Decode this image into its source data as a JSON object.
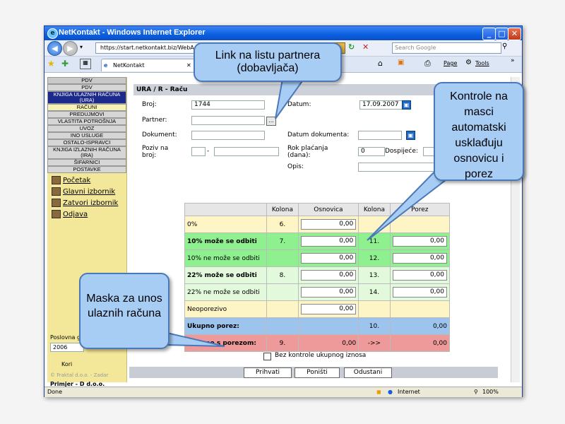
{
  "window": {
    "title": "NetKontakt - Windows Internet Explorer"
  },
  "browser": {
    "url": "https://start.netkontakt.biz/WebA",
    "search_placeholder": "Search Google",
    "tab_label": "NetKontakt",
    "page_menu": "Page",
    "tools_menu": "Tools",
    "status_left": "Done",
    "status_zone": "Internet",
    "zoom": "100%"
  },
  "sidebar": {
    "menu": [
      "PDV",
      "PDV",
      "KNJIGA ULAZNIH RAČUNA (URA)",
      "RAČUNI",
      "PREDUJMOVI",
      "VLASTITA POTROŠNJA",
      "UVOZ",
      "INO USLUGE",
      "OSTALO-ISPRAVCI",
      "KNJIGA IZLAZNIH RAČUNA (IRA)",
      "ŠIFARNICI",
      "POSTAVKE"
    ],
    "links": [
      "Početak",
      "Glavni izbornik",
      "Zatvori izbornik",
      "Odjava"
    ],
    "year_label": "Poslovna g",
    "year_value": "2006",
    "user_label": "Kori",
    "company": "Primjer - D d.o.o.",
    "footer": "© Fraktal d.o.o. - Zadar"
  },
  "form": {
    "header": "URA / R - Raču",
    "broj_label": "Broj:",
    "broj_value": "1744",
    "datum_label": "Datum:",
    "datum_value": "17.09.2007",
    "partner_label": "Partner:",
    "partner_btn": "...",
    "dokument_label": "Dokument:",
    "datum_dok_label": "Datum dokumenta:",
    "poziv_label": "Poziv na broj:",
    "poziv_sep": "-",
    "rok_label": "Rok plaćanja (dana):",
    "rok_value": "0",
    "dospijece_label": "Dospijeće:",
    "opis_label": "Opis:",
    "checkbox_label": "Bez kontrole ukupnog iznosa"
  },
  "table": {
    "headers": [
      "",
      "Kolona",
      "Osnovica",
      "Kolona",
      "Porez"
    ],
    "rows": [
      {
        "label": "0%",
        "k1": "6.",
        "osn": "0,00",
        "k2": "",
        "porez": ""
      },
      {
        "label": "10% može se odbiti",
        "k1": "7.",
        "osn": "0,00",
        "k2": "11.",
        "porez": "0,00"
      },
      {
        "label": "10% ne može se odbiti",
        "k1": "",
        "osn": "0,00",
        "k2": "12.",
        "porez": "0,00"
      },
      {
        "label": "22% može se odbiti",
        "k1": "8.",
        "osn": "0,00",
        "k2": "13.",
        "porez": "0,00"
      },
      {
        "label": "22% ne može se odbiti",
        "k1": "",
        "osn": "0,00",
        "k2": "14.",
        "porez": "0,00"
      },
      {
        "label": "Neoporezivo",
        "k1": "",
        "osn": "0,00",
        "k2": "",
        "porez": ""
      },
      {
        "label": "Ukupno porez:",
        "k1": "",
        "osn": "",
        "k2": "10.",
        "porez": "0,00"
      },
      {
        "label": "Ukupno s porezom:",
        "k1": "9.",
        "osn": "0,00",
        "k2": "->>",
        "porez": "0,00"
      }
    ]
  },
  "buttons": {
    "prihvati": "Prihvati",
    "ponisti": "Poništi",
    "odustani": "Odustani"
  },
  "callouts": {
    "partner": "Link na listu partnera (dobavljača)",
    "controls": "Kontrole na masci automatski usklađuju osnovicu i porez",
    "mask": "Maska za unos ulaznih računa"
  }
}
